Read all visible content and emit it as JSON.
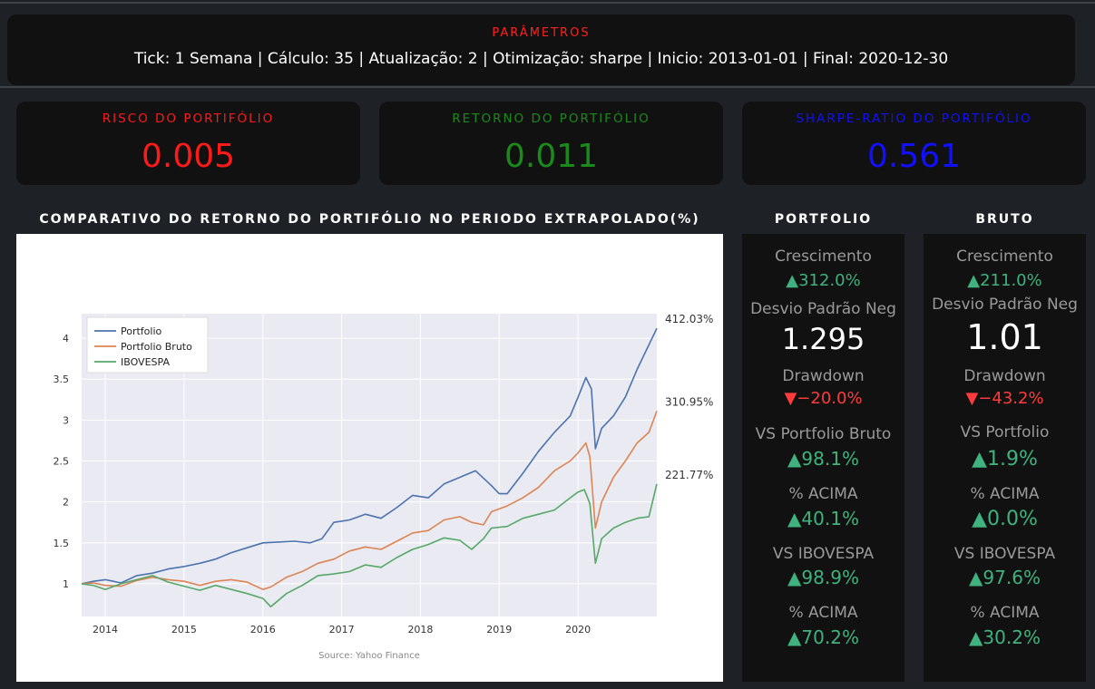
{
  "params": {
    "title": "PARÂMETROS",
    "text": "Tick: 1 Semana | Cálculo: 35 | Atualização: 2 | Otimização: sharpe | Inicio: 2013-01-01 | Final: 2020-12-30"
  },
  "cards": [
    {
      "label": "RISCO DO PORTIFÓLIO",
      "value": "0.005",
      "color": "#ff1a1a"
    },
    {
      "label": "RETORNO DO PORTIFÓLIO",
      "value": "0.011",
      "color": "#1a8a1a"
    },
    {
      "label": "SHARPE-RATIO DO PORTIFÓLIO",
      "value": "0.561",
      "color": "#1010ff"
    }
  ],
  "chart_title": "COMPARATIVO DO RETORNO DO PORTIFÓLIO NO PERIODO EXTRAPOLADO(%)",
  "chart_data": {
    "type": "line",
    "xlabel": "",
    "ylabel": "",
    "x_ticks": [
      "2014",
      "2015",
      "2016",
      "2017",
      "2018",
      "2019",
      "2020"
    ],
    "y_ticks": [
      "1",
      "1.5",
      "2",
      "2.5",
      "3",
      "3.5",
      "4"
    ],
    "xlim": [
      2013.7,
      2021.0
    ],
    "ylim": [
      0.6,
      4.3
    ],
    "grid": true,
    "legend_position": "top-left",
    "source": "Source: Yahoo Finance",
    "series": [
      {
        "name": "Portfolio",
        "color": "#4c72b0",
        "end_label": "412.03%",
        "points": [
          [
            2013.7,
            1.0
          ],
          [
            2013.85,
            1.03
          ],
          [
            2014.0,
            1.05
          ],
          [
            2014.2,
            1.01
          ],
          [
            2014.4,
            1.1
          ],
          [
            2014.6,
            1.13
          ],
          [
            2014.8,
            1.18
          ],
          [
            2015.0,
            1.21
          ],
          [
            2015.2,
            1.25
          ],
          [
            2015.4,
            1.3
          ],
          [
            2015.6,
            1.38
          ],
          [
            2015.8,
            1.44
          ],
          [
            2016.0,
            1.5
          ],
          [
            2016.2,
            1.51
          ],
          [
            2016.4,
            1.52
          ],
          [
            2016.6,
            1.5
          ],
          [
            2016.75,
            1.55
          ],
          [
            2016.9,
            1.75
          ],
          [
            2017.1,
            1.78
          ],
          [
            2017.3,
            1.85
          ],
          [
            2017.5,
            1.8
          ],
          [
            2017.7,
            1.93
          ],
          [
            2017.9,
            2.08
          ],
          [
            2018.1,
            2.05
          ],
          [
            2018.3,
            2.22
          ],
          [
            2018.5,
            2.3
          ],
          [
            2018.7,
            2.38
          ],
          [
            2018.9,
            2.2
          ],
          [
            2019.0,
            2.1
          ],
          [
            2019.1,
            2.1
          ],
          [
            2019.3,
            2.35
          ],
          [
            2019.5,
            2.62
          ],
          [
            2019.7,
            2.85
          ],
          [
            2019.9,
            3.05
          ],
          [
            2020.0,
            3.28
          ],
          [
            2020.1,
            3.52
          ],
          [
            2020.17,
            3.38
          ],
          [
            2020.22,
            2.65
          ],
          [
            2020.3,
            2.9
          ],
          [
            2020.45,
            3.05
          ],
          [
            2020.6,
            3.28
          ],
          [
            2020.75,
            3.62
          ],
          [
            2020.9,
            3.92
          ],
          [
            2021.0,
            4.12
          ]
        ]
      },
      {
        "name": "Portfolio Bruto",
        "color": "#dd8452",
        "end_label": "310.95%",
        "points": [
          [
            2013.7,
            1.0
          ],
          [
            2013.85,
            1.01
          ],
          [
            2014.0,
            0.98
          ],
          [
            2014.2,
            0.97
          ],
          [
            2014.4,
            1.04
          ],
          [
            2014.6,
            1.08
          ],
          [
            2014.8,
            1.05
          ],
          [
            2015.0,
            1.03
          ],
          [
            2015.2,
            0.98
          ],
          [
            2015.4,
            1.03
          ],
          [
            2015.6,
            1.05
          ],
          [
            2015.8,
            1.02
          ],
          [
            2016.0,
            0.93
          ],
          [
            2016.1,
            0.96
          ],
          [
            2016.3,
            1.08
          ],
          [
            2016.5,
            1.15
          ],
          [
            2016.7,
            1.25
          ],
          [
            2016.9,
            1.3
          ],
          [
            2017.1,
            1.4
          ],
          [
            2017.3,
            1.45
          ],
          [
            2017.5,
            1.42
          ],
          [
            2017.7,
            1.52
          ],
          [
            2017.9,
            1.62
          ],
          [
            2018.1,
            1.65
          ],
          [
            2018.3,
            1.78
          ],
          [
            2018.5,
            1.82
          ],
          [
            2018.65,
            1.75
          ],
          [
            2018.8,
            1.72
          ],
          [
            2018.9,
            1.88
          ],
          [
            2019.1,
            1.95
          ],
          [
            2019.3,
            2.05
          ],
          [
            2019.5,
            2.18
          ],
          [
            2019.7,
            2.38
          ],
          [
            2019.9,
            2.5
          ],
          [
            2020.0,
            2.6
          ],
          [
            2020.1,
            2.72
          ],
          [
            2020.15,
            2.55
          ],
          [
            2020.22,
            1.68
          ],
          [
            2020.3,
            2.0
          ],
          [
            2020.45,
            2.3
          ],
          [
            2020.6,
            2.5
          ],
          [
            2020.75,
            2.72
          ],
          [
            2020.9,
            2.85
          ],
          [
            2021.0,
            3.11
          ]
        ]
      },
      {
        "name": "IBOVESPA",
        "color": "#55a868",
        "end_label": "221.77%",
        "points": [
          [
            2013.7,
            1.0
          ],
          [
            2013.85,
            0.98
          ],
          [
            2014.0,
            0.93
          ],
          [
            2014.2,
            1.0
          ],
          [
            2014.4,
            1.05
          ],
          [
            2014.6,
            1.1
          ],
          [
            2014.8,
            1.02
          ],
          [
            2015.0,
            0.97
          ],
          [
            2015.2,
            0.92
          ],
          [
            2015.4,
            0.98
          ],
          [
            2015.6,
            0.93
          ],
          [
            2015.8,
            0.88
          ],
          [
            2016.0,
            0.82
          ],
          [
            2016.1,
            0.72
          ],
          [
            2016.3,
            0.88
          ],
          [
            2016.5,
            0.98
          ],
          [
            2016.7,
            1.1
          ],
          [
            2016.9,
            1.12
          ],
          [
            2017.1,
            1.15
          ],
          [
            2017.3,
            1.23
          ],
          [
            2017.5,
            1.2
          ],
          [
            2017.7,
            1.32
          ],
          [
            2017.9,
            1.42
          ],
          [
            2018.1,
            1.48
          ],
          [
            2018.3,
            1.56
          ],
          [
            2018.5,
            1.53
          ],
          [
            2018.65,
            1.42
          ],
          [
            2018.8,
            1.55
          ],
          [
            2018.9,
            1.68
          ],
          [
            2019.1,
            1.7
          ],
          [
            2019.3,
            1.8
          ],
          [
            2019.5,
            1.85
          ],
          [
            2019.7,
            1.9
          ],
          [
            2019.9,
            2.05
          ],
          [
            2020.0,
            2.12
          ],
          [
            2020.08,
            2.15
          ],
          [
            2020.15,
            1.98
          ],
          [
            2020.22,
            1.25
          ],
          [
            2020.3,
            1.55
          ],
          [
            2020.45,
            1.68
          ],
          [
            2020.6,
            1.75
          ],
          [
            2020.75,
            1.8
          ],
          [
            2020.9,
            1.82
          ],
          [
            2021.0,
            2.22
          ]
        ]
      }
    ]
  },
  "portfolio": {
    "title": "PORTFOLIO",
    "crescimento_label": "Crescimento",
    "crescimento_value": "▲312.0%",
    "desvio_label": "Desvio Padrão Neg",
    "desvio_value": "1.295",
    "drawdown_label": "Drawdown",
    "drawdown_value": "▼−20.0%",
    "vs1_label": "VS Portfolio Bruto",
    "vs1_value": "▲98.1%",
    "acima1_label": "% ACIMA",
    "acima1_value": "▲40.1%",
    "vs2_label": "VS IBOVESPA",
    "vs2_value": "▲98.9%",
    "acima2_label": "% ACIMA",
    "acima2_value": "▲70.2%"
  },
  "bruto": {
    "title": "BRUTO",
    "crescimento_label": "Crescimento",
    "crescimento_value": "▲211.0%",
    "desvio_label": "Desvio Padrão Neg",
    "desvio_value": "1.01",
    "drawdown_label": "Drawdown",
    "drawdown_value": "▼−43.2%",
    "vs1_label": "VS Portfolio",
    "vs1_value": "▲1.9%",
    "acima1_label": "% ACIMA",
    "acima1_value": "▲0.0%",
    "vs2_label": "VS IBOVESPA",
    "vs2_value": "▲97.6%",
    "acima2_label": "% ACIMA",
    "acima2_value": "▲30.2%"
  }
}
